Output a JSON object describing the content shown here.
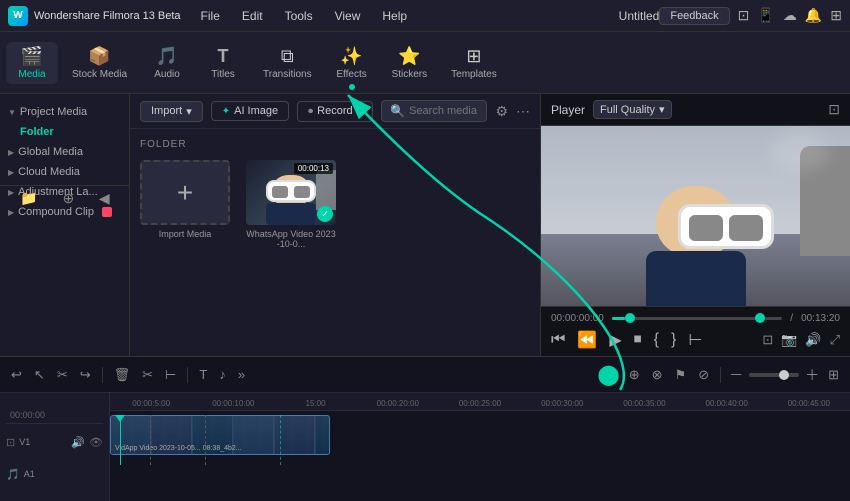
{
  "app": {
    "title": "Wondershare Filmora 13 Beta",
    "doc_title": "Untitled",
    "feedback_btn": "Feedback"
  },
  "menu": {
    "items": [
      "File",
      "Edit",
      "Tools",
      "View",
      "Help"
    ]
  },
  "toolbar": {
    "items": [
      {
        "id": "media",
        "icon": "🎬",
        "label": "Media",
        "active": true
      },
      {
        "id": "stock",
        "icon": "📦",
        "label": "Stock Media",
        "active": false
      },
      {
        "id": "audio",
        "icon": "🎵",
        "label": "Audio",
        "active": false
      },
      {
        "id": "titles",
        "icon": "T",
        "label": "Titles",
        "active": false
      },
      {
        "id": "transitions",
        "icon": "⧉",
        "label": "Transitions",
        "active": false
      },
      {
        "id": "effects",
        "icon": "✨",
        "label": "Effects",
        "active": false
      },
      {
        "id": "stickers",
        "icon": "⭐",
        "label": "Stickers",
        "active": false
      },
      {
        "id": "templates",
        "icon": "⊞",
        "label": "Templates",
        "active": false
      }
    ]
  },
  "left_panel": {
    "project_media": "Project Media",
    "folder": "Folder",
    "sections": [
      {
        "label": "Global Media"
      },
      {
        "label": "Cloud Media"
      },
      {
        "label": "Adjustment La..."
      },
      {
        "label": "Compound Clip"
      }
    ]
  },
  "media_bar": {
    "import": "Import",
    "ai_image": "AI Image",
    "record": "Record",
    "search_placeholder": "Search media",
    "folder_label": "FOLDER"
  },
  "media_items": [
    {
      "id": "import",
      "type": "import",
      "label": "Import Media"
    },
    {
      "id": "video1",
      "type": "video",
      "label": "WhatsApp Video 2023-10-0...",
      "duration": "00:00:13"
    }
  ],
  "player": {
    "label": "Player",
    "quality": "Full Quality",
    "current_time": "00:00:00:00",
    "total_time": "00:13:20"
  },
  "timeline": {
    "rulers": [
      "00:00:5:00",
      "00:00:10:00",
      "15:00",
      "00:00:20:00",
      "00:00:25:00",
      "00:00:30:00",
      "00:00:35:00",
      "00:00:40:00",
      "00:00:45:00"
    ],
    "clip_label": "VidApp Video 2023-10-05... 08:38_4b2..."
  }
}
